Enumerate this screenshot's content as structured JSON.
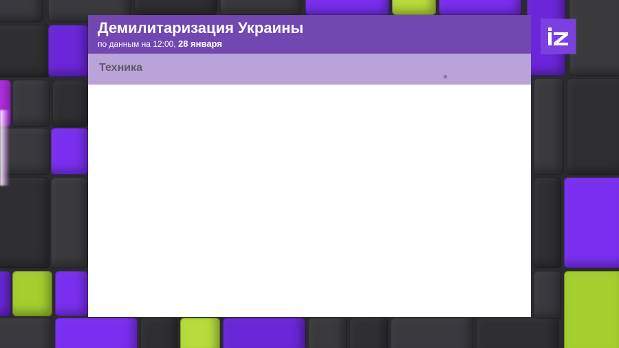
{
  "card": {
    "title": "Демилитаризация Украины",
    "subtitle_prefix": "по данным на 12:00, ",
    "subtitle_date": "28 января"
  },
  "section": {
    "label": "Техника"
  },
  "logo": {
    "icon": "iz-logo"
  },
  "colors": {
    "header": "#7347b2",
    "section_bar": "#b9a3d9",
    "accent_purple": "#7a2ff0",
    "accent_lime": "#a4cf2e"
  }
}
